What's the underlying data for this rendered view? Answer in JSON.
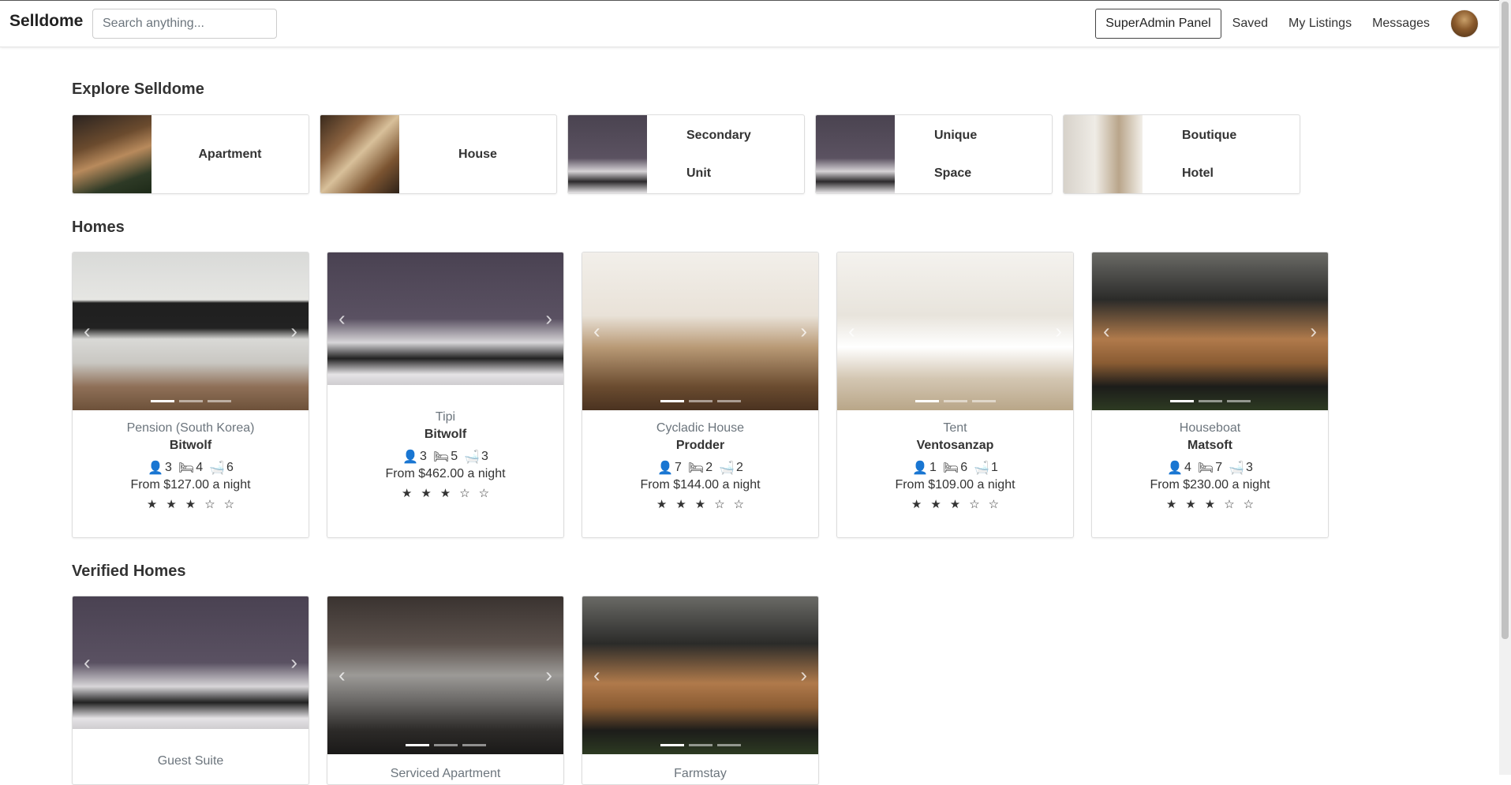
{
  "nav": {
    "brand": "Selldome",
    "search_placeholder": "Search anything...",
    "superadmin": "SuperAdmin Panel",
    "saved": "Saved",
    "my_listings": "My Listings",
    "messages": "Messages"
  },
  "explore": {
    "title": "Explore Selldome",
    "categories": [
      {
        "line1": "Apartment",
        "line2": ""
      },
      {
        "line1": "House",
        "line2": ""
      },
      {
        "line1": "Secondary",
        "line2": "Unit"
      },
      {
        "line1": "Unique",
        "line2": "Space"
      },
      {
        "line1": "Boutique",
        "line2": "Hotel"
      }
    ]
  },
  "homes": {
    "title": "Homes",
    "items": [
      {
        "type": "Pension (South Korea)",
        "name": "Bitwolf",
        "guests": "3",
        "beds": "4",
        "baths": "6",
        "price": "From $127.00 a night",
        "stars": "★★★☆☆"
      },
      {
        "type": "Tipi",
        "name": "Bitwolf",
        "guests": "3",
        "beds": "5",
        "baths": "3",
        "price": "From $462.00 a night",
        "stars": "★★★☆☆"
      },
      {
        "type": "Cycladic House",
        "name": "Prodder",
        "guests": "7",
        "beds": "2",
        "baths": "2",
        "price": "From $144.00 a night",
        "stars": "★★★☆☆"
      },
      {
        "type": "Tent",
        "name": "Ventosanzap",
        "guests": "1",
        "beds": "6",
        "baths": "1",
        "price": "From $109.00 a night",
        "stars": "★★★☆☆"
      },
      {
        "type": "Houseboat",
        "name": "Matsoft",
        "guests": "4",
        "beds": "7",
        "baths": "3",
        "price": "From $230.00 a night",
        "stars": "★★★☆☆"
      }
    ]
  },
  "verified": {
    "title": "Verified Homes",
    "items": [
      {
        "type": "Guest Suite"
      },
      {
        "type": "Serviced Apartment"
      },
      {
        "type": "Farmstay"
      }
    ]
  },
  "icons": {
    "guests": "user-icon",
    "beds": "bed-icon",
    "baths": "bath-icon",
    "prev": "chevron-left-icon",
    "next": "chevron-right-icon"
  }
}
